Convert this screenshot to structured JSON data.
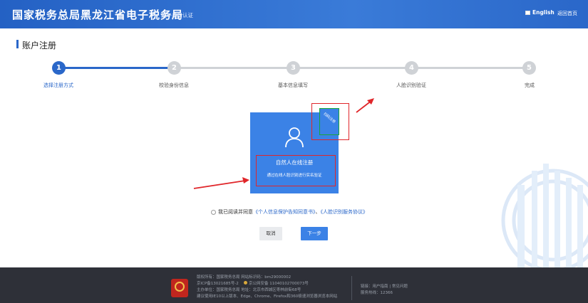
{
  "header": {
    "brand": "国家税务总局黑龙江省电子税务局",
    "separator": "|",
    "subtitle": "统一身份认证",
    "language": "English",
    "home_link": "返回首页"
  },
  "page": {
    "title": "账户注册"
  },
  "steps": [
    {
      "number": "1",
      "label": "选择注册方式",
      "active": true
    },
    {
      "number": "2",
      "label": "校验身份信息",
      "active": false
    },
    {
      "number": "3",
      "label": "基本信息填写",
      "active": false
    },
    {
      "number": "4",
      "label": "人脸识别验证",
      "active": false
    },
    {
      "number": "5",
      "label": "完成",
      "active": false
    }
  ],
  "register_card": {
    "icon": "user-icon",
    "title": "自然人在线注册",
    "description": "通过在线人脸识别进行实名验证",
    "badge": "扫码注册"
  },
  "agreement": {
    "prefix": "我已阅读并同意",
    "link1": "《个人信息保护告知同意书》",
    "joiner": "、",
    "link2": "《人脸识别服务协议》"
  },
  "buttons": {
    "cancel": "取消",
    "next": "下一步"
  },
  "footer": {
    "line1": "版权所有：国家税务总局   网站标识码：bm29000002",
    "line2a": "京ICP备13021685号-2",
    "line2b": "京公网安备 11040102700073号",
    "line3": "主办单位：国家税务总局   地址：北京市西城区枣林前街68号",
    "line4": "建议使用IE10以上版本、Edge、Chrome、Firefox和360极速浏览器浏览本网站",
    "links": "链接：用户指南  |  常见问题",
    "hotline": "服务热线：12366"
  },
  "colors": {
    "primary": "#2a67c9",
    "card": "#3b82e6",
    "highlight": "#e0262a",
    "footer": "#2e3038"
  }
}
